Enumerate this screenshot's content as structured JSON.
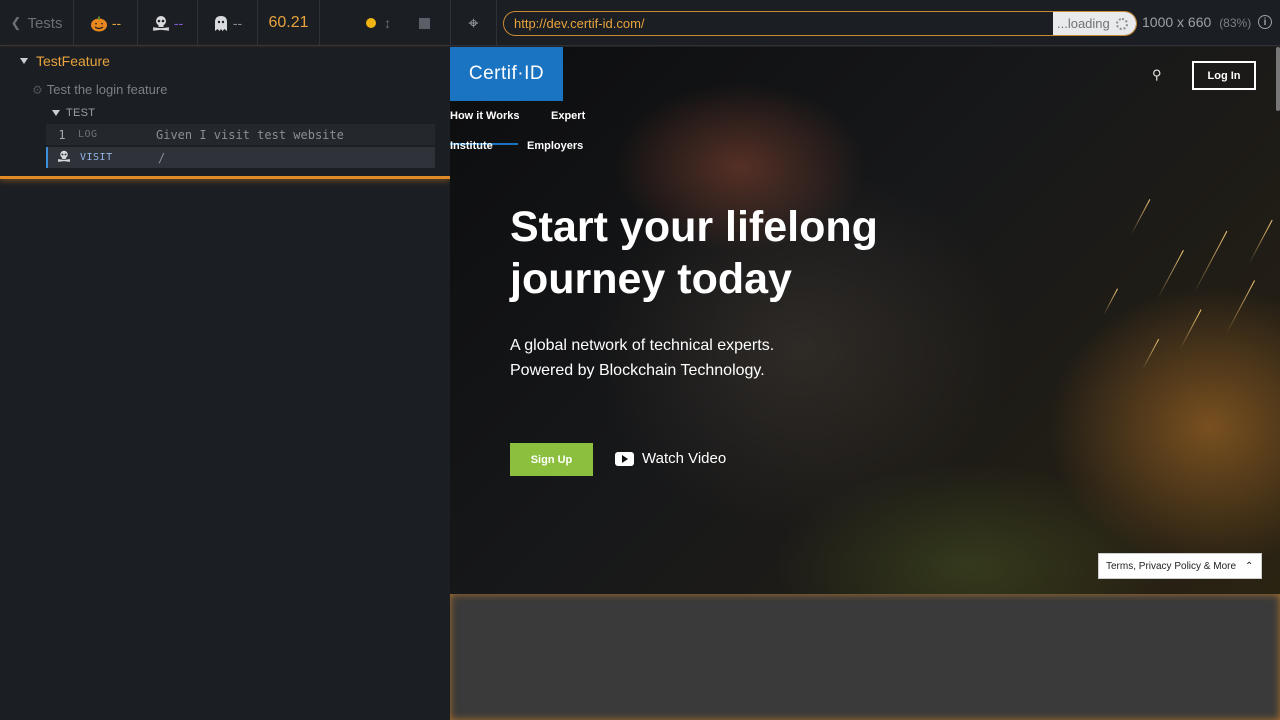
{
  "reporter": {
    "tests_label": "Tests",
    "stats": {
      "passed_icon": "pumpkin-icon",
      "passed": "--",
      "failed_icon": "skull-icon",
      "failed": "--",
      "pending_icon": "ghost-icon",
      "pending": "--"
    },
    "duration": "60.21",
    "suite": {
      "title": "TestFeature",
      "test_title": "Test the login feature",
      "section": "TEST",
      "commands": [
        {
          "num": "1",
          "name": "LOG",
          "message": "Given I visit test website"
        },
        {
          "num": "",
          "name": "VISIT",
          "message": "/"
        }
      ]
    }
  },
  "aut": {
    "url": "http://dev.certif-id.com/",
    "loading_label": "...loading",
    "viewport_size": "1000 x 660",
    "viewport_scale": "(83%)"
  },
  "site": {
    "logo": "Certif·ID",
    "login_label": "Log In",
    "nav": [
      "How it Works",
      "Expert",
      "Institute",
      "Employers"
    ],
    "hero_title": "Start your lifelong journey today",
    "hero_sub1": "A global network of technical experts.",
    "hero_sub2": "Powered by Blockchain Technology.",
    "signup_label": "Sign Up",
    "watch_video_label": "Watch Video",
    "terms_label": "Terms, Privacy Policy & More"
  },
  "colors": {
    "accent": "#e8a33c",
    "brand_blue": "#1b74c2",
    "signup_green": "#8bbf3d"
  }
}
